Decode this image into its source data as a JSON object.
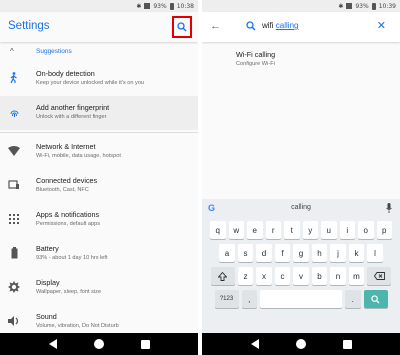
{
  "status_left": {
    "battery": "93%",
    "time": "10:38"
  },
  "status_right": {
    "battery": "93%",
    "time": "10:39"
  },
  "settings": {
    "title": "Settings",
    "suggestions_label": "Suggestions",
    "items": [
      {
        "title": "On-body detection",
        "subtitle": "Keep your device unlocked while it's on you",
        "icon": "person-walking-icon"
      },
      {
        "title": "Add another fingerprint",
        "subtitle": "Unlock with a different finger",
        "icon": "fingerprint-icon"
      },
      {
        "title": "Network & Internet",
        "subtitle": "Wi-Fi, mobile, data usage, hotspot",
        "icon": "wifi-icon"
      },
      {
        "title": "Connected devices",
        "subtitle": "Bluetooth, Cast, NFC",
        "icon": "devices-icon"
      },
      {
        "title": "Apps & notifications",
        "subtitle": "Permissions, default apps",
        "icon": "apps-grid-icon"
      },
      {
        "title": "Battery",
        "subtitle": "93% - about 1 day 10 hrs left",
        "icon": "battery-icon"
      },
      {
        "title": "Display",
        "subtitle": "Wallpaper, sleep, font size",
        "icon": "brightness-icon"
      },
      {
        "title": "Sound",
        "subtitle": "Volume, vibration, Do Not Disturb",
        "icon": "volume-icon"
      }
    ]
  },
  "search": {
    "query_plain": "wifi",
    "query_underlined": "calling",
    "result": {
      "title": "Wi-Fi calling",
      "subtitle": "Configure Wi-Fi"
    }
  },
  "keyboard": {
    "suggestion": "calling",
    "g_logo": "G",
    "row1": [
      "q",
      "w",
      "e",
      "r",
      "t",
      "y",
      "u",
      "i",
      "o",
      "p"
    ],
    "row2": [
      "a",
      "s",
      "d",
      "f",
      "g",
      "h",
      "j",
      "k",
      "l"
    ],
    "row3": [
      "z",
      "x",
      "c",
      "v",
      "b",
      "n",
      "m"
    ],
    "symbols_key": "?123",
    "comma": ",",
    "period": "."
  },
  "colors": {
    "accent": "#1a73e8",
    "highlight": "#e00000",
    "action_key": "#4db6ac"
  }
}
